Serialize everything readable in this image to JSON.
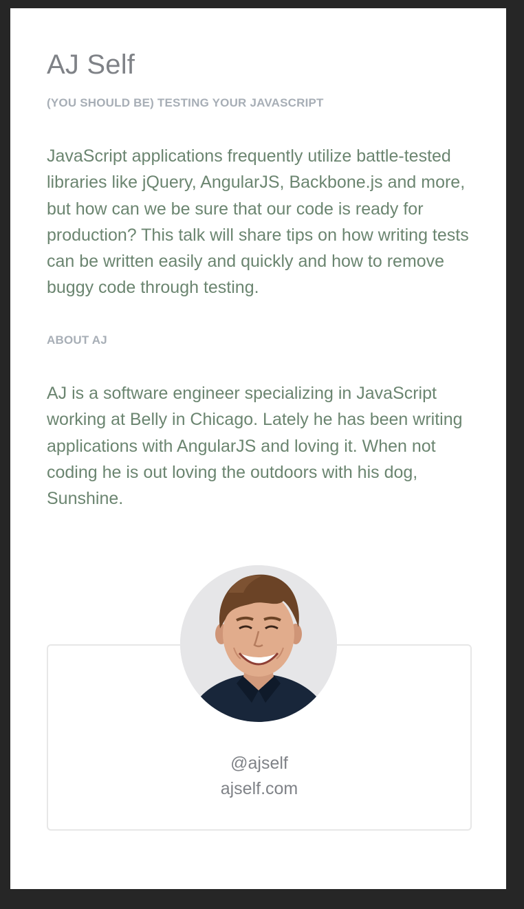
{
  "speaker": {
    "name": "AJ Self"
  },
  "talk": {
    "title": "(YOU SHOULD BE) TESTING YOUR JAVASCRIPT",
    "description": "JavaScript applications frequently utilize battle-tested libraries like jQuery, AngularJS, Backbone.js and more, but how can we be sure that our code is ready for production? This talk will share tips on how writing tests can be written easily and quickly and how to remove buggy code through testing."
  },
  "about": {
    "heading": "ABOUT AJ",
    "bio": "AJ is a software engineer specializing in JavaScript working at Belly in Chicago. Lately he has been writing applications with AngularJS and loving it. When not coding he is out loving the outdoors with his dog, Sunshine."
  },
  "card": {
    "twitter": "@ajself",
    "website": "ajself.com"
  },
  "colors": {
    "background": "#262626",
    "page": "#ffffff",
    "body_text": "#6b8570",
    "heading": "#a7aeb6",
    "name": "#7f8287",
    "card_border": "#e7e7e7"
  },
  "icons": {
    "avatar": "speaker-photo"
  }
}
